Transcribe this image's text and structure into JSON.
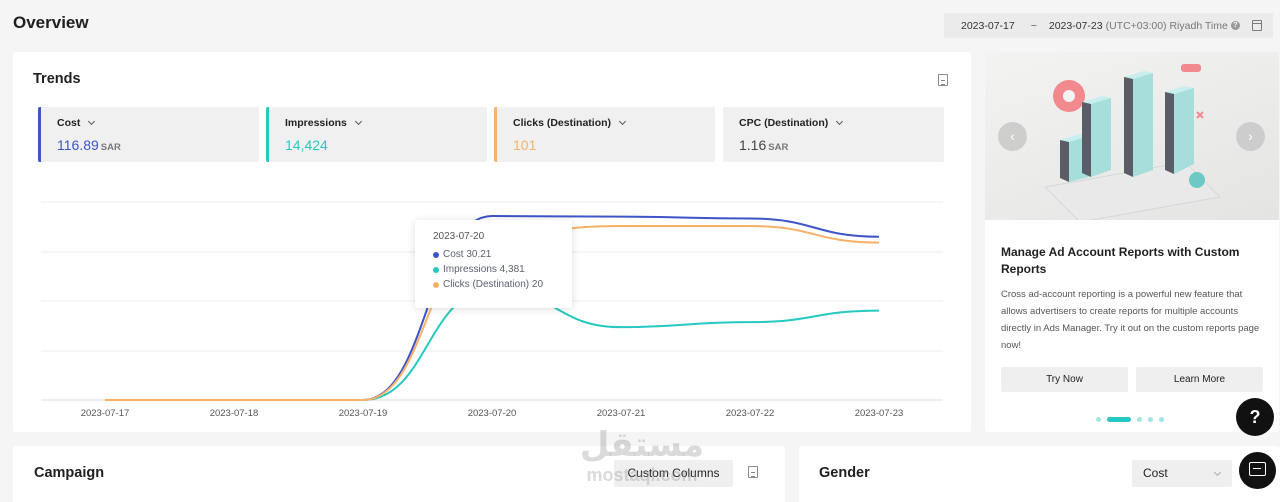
{
  "header": {
    "title": "Overview",
    "date_start": "2023-07-17",
    "date_sep": "~",
    "date_end": "2023-07-23",
    "timezone": "(UTC+03:00) Riyadh Time"
  },
  "trends": {
    "title": "Trends",
    "metrics": [
      {
        "label": "Cost",
        "value": "116.89",
        "unit": "SAR",
        "color": "#3d55c8"
      },
      {
        "label": "Impressions",
        "value": "14,424",
        "unit": "",
        "color": "#25c9c0"
      },
      {
        "label": "Clicks (Destination)",
        "value": "101",
        "unit": "",
        "color": "#f7b267"
      },
      {
        "label": "CPC (Destination)",
        "value": "1.16",
        "unit": "SAR",
        "color": "#444444"
      }
    ],
    "tooltip": {
      "date": "2023-07-20",
      "rows": [
        {
          "label": "Cost 30.21",
          "color": "#3d55c8"
        },
        {
          "label": "Impressions 4,381",
          "color": "#25c9c0"
        },
        {
          "label": "Clicks (Destination) 20",
          "color": "#f7b267"
        }
      ]
    }
  },
  "chart_data": {
    "type": "line",
    "x": [
      "2023-07-17",
      "2023-07-18",
      "2023-07-19",
      "2023-07-20",
      "2023-07-21",
      "2023-07-22",
      "2023-07-23"
    ],
    "series": [
      {
        "name": "Cost",
        "color": "#3d55c8",
        "values": [
          0,
          0,
          0,
          30.21,
          30.1,
          29.8,
          26.8
        ]
      },
      {
        "name": "Impressions",
        "color": "#25c9c0",
        "values": [
          0,
          0,
          0,
          4381,
          2900,
          3100,
          3560
        ]
      },
      {
        "name": "Clicks (Destination)",
        "color": "#f7b267",
        "values": [
          0,
          0,
          0,
          20,
          21,
          21,
          19
        ]
      }
    ],
    "grid": true,
    "xlabel": "",
    "ylabel": ""
  },
  "promo": {
    "title": "Manage Ad Account Reports with Custom Reports",
    "body": "Cross ad-account reporting is a powerful new feature that allows advertisers to create reports for multiple accounts directly in Ads Manager. Try it out on the custom reports page now!",
    "try_now": "Try Now",
    "learn_more": "Learn More",
    "prev": "‹",
    "next": "›",
    "slide_count": 5,
    "active_slide": 2
  },
  "campaign": {
    "title": "Campaign",
    "custom_columns": "Custom Columns"
  },
  "gender": {
    "title": "Gender",
    "metric_select": "Cost"
  },
  "floating": {
    "help": "?"
  },
  "watermark": {
    "arabic": "مستقل",
    "latin": "mostaql.com"
  }
}
